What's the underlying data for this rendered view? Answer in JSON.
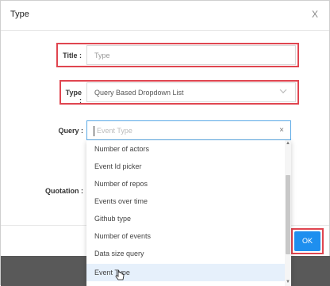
{
  "dialog": {
    "title": "Type",
    "close_label": "X"
  },
  "form": {
    "title_label": "Title :",
    "title_placeholder": "Type",
    "type_label": "Type :",
    "type_value": "Query Based Dropdown List",
    "query_label": "Query :",
    "query_placeholder": "Event Type",
    "quotation_label": "Quotation :"
  },
  "dropdown": {
    "items": [
      "Number of actors",
      "Event Id picker",
      "Number of repos",
      "Events over time",
      "Github type",
      "Number of events",
      "Data size query",
      "Event Type"
    ],
    "active_index": 7
  },
  "footer": {
    "ok_label": "OK"
  },
  "colors": {
    "highlight": "#e04550",
    "primary": "#1e8fef",
    "focus_border": "#5aa9e6"
  }
}
